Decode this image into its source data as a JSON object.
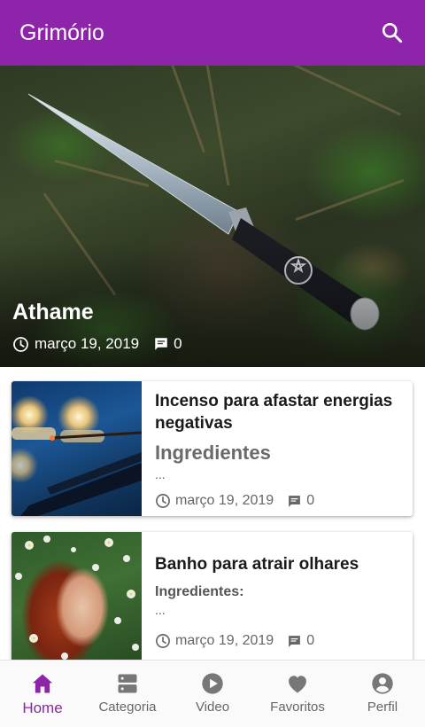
{
  "app": {
    "title": "Grimório",
    "accent": "#8e24aa"
  },
  "appbar": {
    "search_icon": "search-icon"
  },
  "featured": {
    "title": "Athame",
    "date": "março 19, 2019",
    "comments": "0"
  },
  "posts": [
    {
      "title": "Incenso para afastar energias negativas",
      "subtitle": "Ingredientes",
      "excerpt": "...",
      "date": "março 19, 2019",
      "comments": "0"
    },
    {
      "title": "Banho para atrair olhares",
      "subtitle": "Ingredientes:",
      "excerpt": "...",
      "date": "março 19, 2019",
      "comments": "0"
    }
  ],
  "nav": {
    "items": [
      {
        "label": "Home",
        "icon": "home-icon",
        "active": true
      },
      {
        "label": "Categoria",
        "icon": "category-icon"
      },
      {
        "label": "Video",
        "icon": "play-circle-icon"
      },
      {
        "label": "Favoritos",
        "icon": "heart-icon"
      },
      {
        "label": "Perfil",
        "icon": "account-circle-icon"
      }
    ]
  }
}
